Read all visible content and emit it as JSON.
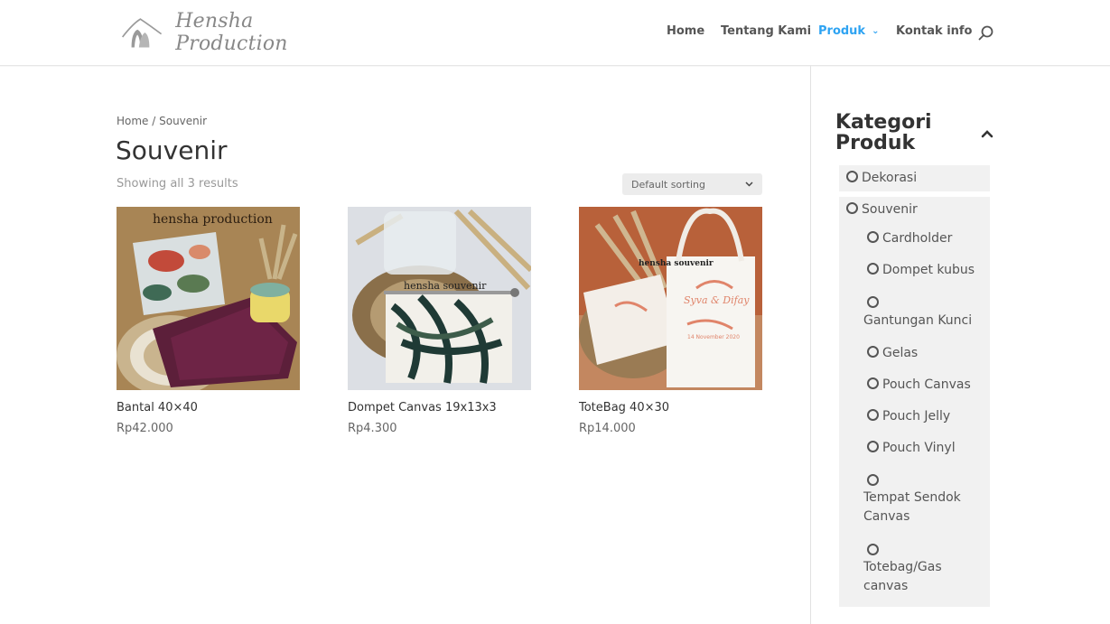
{
  "brand": {
    "name": "Hensha Production"
  },
  "nav": {
    "items": [
      {
        "label": "Home"
      },
      {
        "label": "Tentang Kami"
      },
      {
        "label": "Produk"
      },
      {
        "label": "Kontak info"
      }
    ],
    "active_color": "#2ea3f2",
    "search_icon": "search-icon"
  },
  "breadcrumb": {
    "home": "Home",
    "separator": " / ",
    "current": "Souvenir"
  },
  "page": {
    "title": "Souvenir",
    "results_text": "Showing all 3 results",
    "sort_selected": "Default sorting"
  },
  "products": [
    {
      "name": "Bantal 40×40",
      "price": "Rp42.000",
      "image_caption": "hensha production"
    },
    {
      "name": "Dompet Canvas 19x13x3",
      "price": "Rp4.300",
      "image_caption": "hensha souvenir"
    },
    {
      "name": "ToteBag 40×30",
      "price": "Rp14.000",
      "image_caption": "hensha souvenir",
      "bag_text": "Syva & Difay",
      "bag_date": "14 November 2020"
    }
  ],
  "sidebar": {
    "title_line1": "Kategori",
    "title_line2": "Produk",
    "categories": [
      {
        "label": "Dekorasi"
      },
      {
        "label": "Souvenir"
      }
    ],
    "subcategories": [
      {
        "label": "Cardholder"
      },
      {
        "label": "Dompet kubus"
      },
      {
        "label": "Gantungan Kunci"
      },
      {
        "label": "Gelas"
      },
      {
        "label": "Pouch Canvas"
      },
      {
        "label": "Pouch Jelly"
      },
      {
        "label": "Pouch Vinyl"
      },
      {
        "label": "Tempat Sendok Canvas"
      },
      {
        "label": "Totebag/Gas canvas"
      }
    ]
  }
}
